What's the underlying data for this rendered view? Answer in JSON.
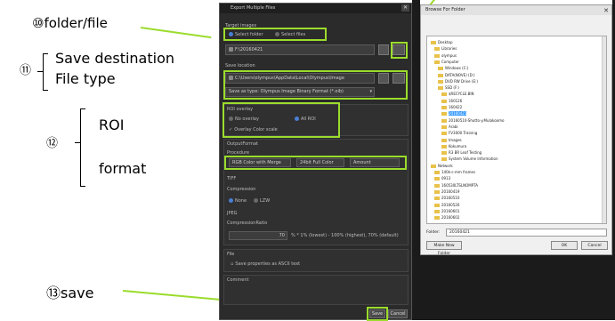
{
  "annotations": {
    "a10": "⑩folder/file",
    "a11_num": "⑪",
    "a11_line1": "Save destination",
    "a11_line2": "File type",
    "a12_num": "⑫",
    "a12_roi": "ROI",
    "a12_format": "format",
    "a13": "⑬save"
  },
  "dialog": {
    "title": "Export Multiple Files",
    "target_images": "Target images",
    "select_folder": "Select folder",
    "select_files": "Select files",
    "folder_path": "F:\\20160421",
    "save_location": "Save location",
    "save_path": "C:\\Users\\olympus\\AppData\\Local\\Olympus\\Image",
    "save_as_type": "Save as type:",
    "file_type": "Olympus Image Binary Format (*.oib)",
    "roi_overlay": "ROI overlay",
    "no_overlay": "No overlay",
    "all_roi": "All ROI",
    "overlay_color_scale": "Overlay Color scale",
    "output_format": "OutputFormat",
    "procedure": "Procedure",
    "rgb_merge": "RGB Color with Merge",
    "full_color": "24bit Full Color",
    "amount": "Amount",
    "tiff": "TIFF",
    "compression": "Compression",
    "none": "None",
    "lzw": "LZW",
    "jpeg": "JPEG",
    "compression_ratio": "CompressionRatio",
    "ratio_value": "70",
    "ratio_hint": "% * 1% (lowest) - 100% (highest), 70% (default)",
    "file": "File",
    "save_ascii": "Save properties as ASCII text",
    "comment": "Comment",
    "save_btn": "Save",
    "cancel_btn": "Cancel"
  },
  "browse": {
    "title": "Browse For Folder",
    "tree": [
      "Desktop",
      "Libraries",
      "olympus",
      "Computer",
      "Windows (C:)",
      "DATA(NOVE) (D:)",
      "DVD RW Drive (E:)",
      "SSD (F:)",
      "$RECYCLE.BIN",
      "160126",
      "160422",
      "20160421",
      "20160510-Shutto-y.Mulakoomo",
      "Arabi",
      "FV3000 Training",
      "Images",
      "Kokumura",
      "R3 BR Leaf Testing",
      "System Volume Information",
      "Network",
      "140k-c-mm frames",
      "0913",
      "160530LTSLNOMPTA",
      "20160419",
      "20160510",
      "20160526",
      "20160601",
      "20160602"
    ],
    "folder_label": "Folder:",
    "folder_value": "20160421",
    "make_new_folder": "Make New Folder",
    "ok": "OK",
    "cancel": "Cancel"
  },
  "colors": {
    "highlight": "#9bdc2c",
    "dialog_bg": "#2b2b2b"
  }
}
